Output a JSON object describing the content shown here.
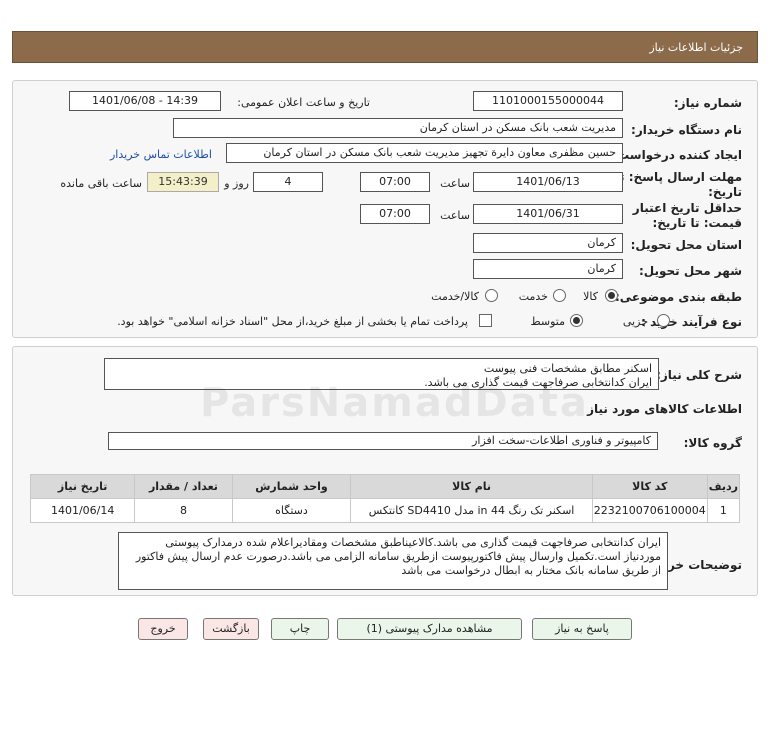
{
  "header": {
    "title": "جزئیات اطلاعات نیاز"
  },
  "info": {
    "need_number_label": "شماره نیاز:",
    "need_number": "1101000155000044",
    "announce_label": "تاریخ و ساعت اعلان عمومی:",
    "announce_value": "1401/06/08 - 14:39",
    "buyer_org_label": "نام دستگاه خریدار:",
    "buyer_org": "مدیریت شعب بانک مسکن در استان کرمان",
    "creator_label": "ایجاد کننده درخواست:",
    "creator": "حسین  مظفری  معاون دایرة تجهیز مدیریت شعب بانک مسکن در استان کرمان",
    "contact_link": "اطلاعات تماس خریدار",
    "deadline_label_1": "مهلت ارسال پاسخ: تا",
    "deadline_label_2": "تاریخ:",
    "deadline_date": "1401/06/13",
    "time_label": "ساعت",
    "deadline_time": "07:00",
    "days_value": "4",
    "days_label": "روز و",
    "remaining_time": "15:43:39",
    "remaining_label": "ساعت باقی مانده",
    "validity_label_1": "حداقل تاریخ اعتبار",
    "validity_label_2": "قیمت: تا تاریخ:",
    "validity_date": "1401/06/31",
    "validity_time": "07:00",
    "province_label": "استان محل تحویل:",
    "province": "کرمان",
    "city_label": "شهر محل تحویل:",
    "city": "کرمان",
    "category_label": "طبقه بندی موضوعی:",
    "category_options": [
      "کالا",
      "خدمت",
      "کالا/خدمت"
    ],
    "category_selected": "کالا",
    "process_label": "نوع فرآیند خرید :",
    "process_options": [
      "جزیی",
      "متوسط"
    ],
    "process_selected": "متوسط",
    "payment_note": "پرداخت تمام یا بخشی از مبلغ خرید،از محل \"اسناد خزانه اسلامی\" خواهد بود."
  },
  "summary": {
    "label": "شرح کلی نیاز:",
    "text": "اسکنر مطابق مشخصات فنی پیوست\nایران کدانتخابی صرفاجهت قیمت گذاری می باشد."
  },
  "goods": {
    "section_title": "اطلاعات کالاهای مورد نیاز",
    "group_label": "گروه کالا:",
    "group_value": "کامپیوتر و فناوری اطلاعات-سخت افزار"
  },
  "table": {
    "headers": [
      "ردیف",
      "کد کالا",
      "نام کالا",
      "واحد شمارش",
      "تعداد / مقدار",
      "تاریخ نیاز"
    ],
    "rows": [
      [
        "1",
        "2232100706100004",
        "اسکنر تک رنگ 44 in مدل SD4410 کانتکس",
        "دستگاه",
        "8",
        "1401/06/14"
      ]
    ]
  },
  "buyer_notes": {
    "label": "توضیحات خریدار:",
    "text": "ایران کدانتخابی صرفاجهت قیمت گذاری می باشد.کالاعیناطبق مشخصات ومقادیراعلام شده درمدارک پیوستی موردنیاز است.تکمیل وارسال پیش فاکتورپیوست ازطریق سامانه الزامی می باشد.درصورت عدم ارسال پیش فاکتور از طریق سامانه بانک مختار به ابطال درخواست می باشد"
  },
  "buttons": {
    "reply": "پاسخ به نیاز",
    "attachments": "مشاهده مدارک پیوستی (1)",
    "print": "چاپ",
    "back": "بازگشت",
    "exit": "خروج"
  },
  "watermark": "ParsNamadData"
}
